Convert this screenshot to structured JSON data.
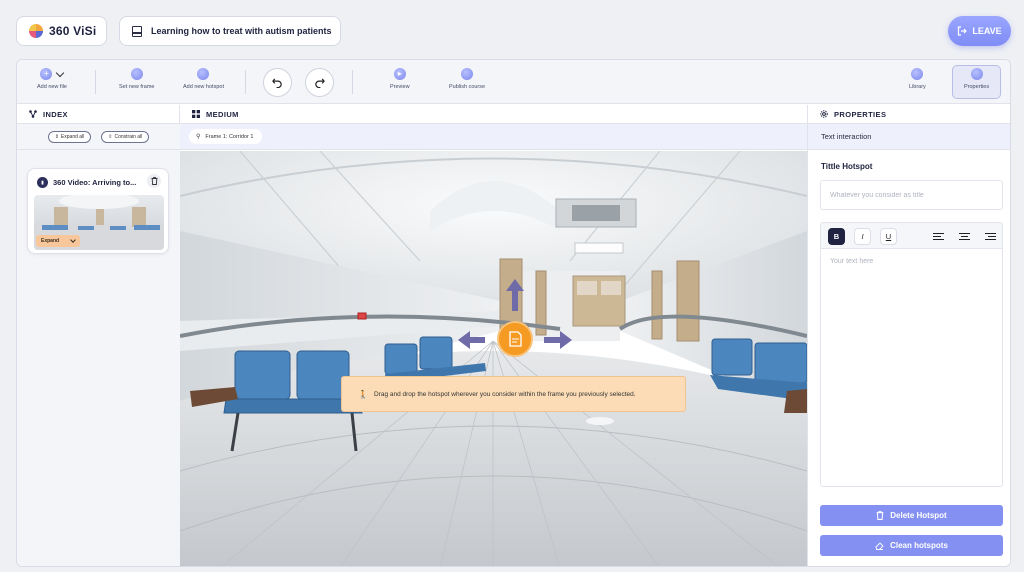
{
  "header": {
    "brand": "360 ViSi",
    "course_title": "Learning how to treat with autism patients",
    "leave_label": "LEAVE"
  },
  "toolbar": {
    "add_file": "Add new file",
    "set_frame": "Set new frame",
    "add_hotspot": "Add new hotspot",
    "preview": "Preview",
    "publish": "Publish course",
    "library": "Library",
    "properties": "Properties"
  },
  "index": {
    "title": "INDEX",
    "expand_all": "Expand all",
    "constrain_all": "Constrain all",
    "card": {
      "title": "360 Video: Arriving to...",
      "expand": "Expand"
    }
  },
  "medium": {
    "title": "MEDIUM",
    "frame_chip": "Frame 1: Corridor 1",
    "toast": "Drag and drop the hotspot wherever you consider within the frame you previously selected."
  },
  "properties": {
    "title": "PROPERTIES",
    "subtitle": "Text interaction",
    "field_label": "Tittle Hotspot",
    "title_placeholder": "Whatever you consider as title",
    "bold": "B",
    "italic": "I",
    "underline": "U",
    "text_placeholder": "Your text here",
    "delete_label": "Delete Hotspot",
    "clean_label": "Clean hotspots"
  },
  "colors": {
    "accent": "#8591f2",
    "hotspot": "#f59a23",
    "toast": "#fbdcb6",
    "arrows": "#6f6aa8"
  }
}
